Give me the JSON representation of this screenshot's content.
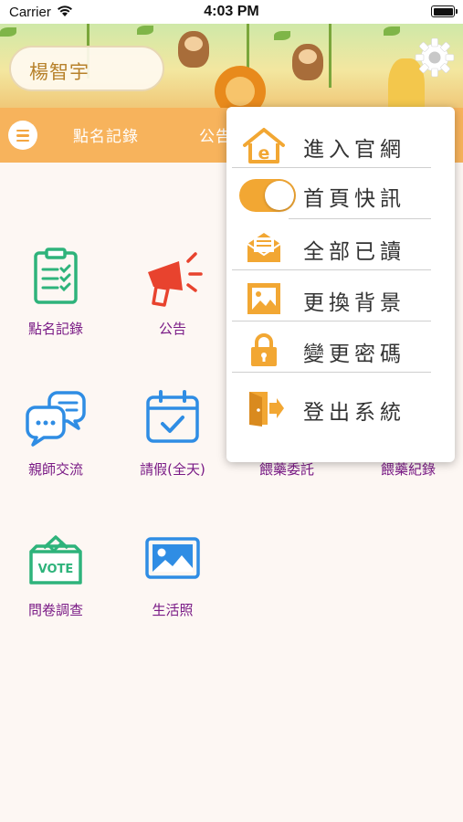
{
  "status_bar": {
    "carrier": "Carrier",
    "time": "4:03 PM"
  },
  "header": {
    "user_name": "楊智宇"
  },
  "tabs": [
    "點名記錄",
    "公告"
  ],
  "grid": [
    {
      "label": "點名記錄",
      "icon": "clipboard-checklist-icon"
    },
    {
      "label": "公告",
      "icon": "megaphone-icon"
    },
    {
      "label": "",
      "icon": ""
    },
    {
      "label": "",
      "icon": ""
    },
    {
      "label": "親師交流",
      "icon": "chat-bubbles-icon"
    },
    {
      "label": "請假(全天)",
      "icon": "calendar-check-icon"
    },
    {
      "label": "餵藥委託",
      "icon": ""
    },
    {
      "label": "餵藥紀錄",
      "icon": ""
    },
    {
      "label": "問卷調查",
      "icon": "vote-box-icon"
    },
    {
      "label": "生活照",
      "icon": "photo-icon"
    }
  ],
  "menu": {
    "items": [
      {
        "label": "進入官網",
        "icon": "home-e-icon"
      },
      {
        "label": "首頁快訊",
        "icon": "toggle-switch",
        "toggle_on": true
      },
      {
        "label": "全部已讀",
        "icon": "open-envelope-icon"
      },
      {
        "label": "更換背景",
        "icon": "picture-frame-icon"
      },
      {
        "label": "變更密碼",
        "icon": "padlock-icon"
      },
      {
        "label": "登出系統",
        "icon": "logout-door-icon"
      }
    ]
  },
  "colors": {
    "accent_orange": "#f7b35c",
    "menu_icon_orange": "#f2a733",
    "grid_green": "#2eb37b",
    "grid_blue": "#2f8de4",
    "grid_red": "#e8432e",
    "label_purple": "#7a1b86"
  }
}
